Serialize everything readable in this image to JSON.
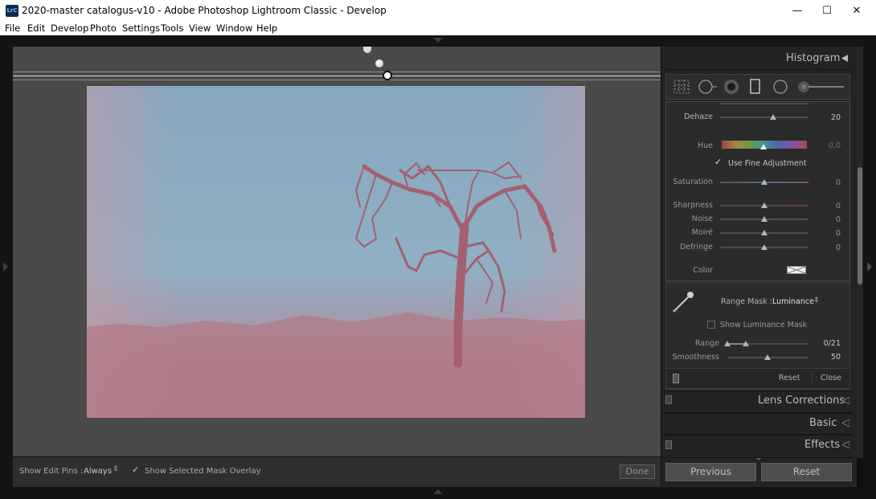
{
  "window": {
    "title": "2020-master catalogus-v10 - Adobe Photoshop Lightroom Classic - Develop",
    "app_icon_text": "LrC",
    "minimize_glyph": "—",
    "maximize_glyph": "☐",
    "close_glyph": "✕"
  },
  "menu": [
    {
      "label": "File"
    },
    {
      "label": "Edit"
    },
    {
      "label": "Develop"
    },
    {
      "label": "Photo"
    },
    {
      "label": "Settings"
    },
    {
      "label": "Tools"
    },
    {
      "label": "View"
    },
    {
      "label": "Window"
    },
    {
      "label": "Help"
    }
  ],
  "toolbar": {
    "show_edit_pins_label": "Show Edit Pins :",
    "show_edit_pins_value": "Always",
    "overlay_label": "Show Selected Mask Overlay",
    "overlay_checked": true,
    "done_label": "Done"
  },
  "panel": {
    "histogram_title": "Histogram",
    "tools": [
      "crop-overlay-icon",
      "spot-removal-icon",
      "red-eye-icon",
      "graduated-filter-icon",
      "radial-filter-icon",
      "adjustment-brush-icon"
    ],
    "sliders": [
      {
        "label": "Dehaze",
        "value": "20",
        "position": 0.6
      },
      {
        "label": "Saturation",
        "value": "0",
        "position": 0.5
      },
      {
        "label": "Sharpness",
        "value": "0",
        "position": 0.5
      },
      {
        "label": "Noise",
        "value": "0",
        "position": 0.5
      },
      {
        "label": "Moiré",
        "value": "0",
        "position": 0.5
      },
      {
        "label": "Defringe",
        "value": "0",
        "position": 0.5
      }
    ],
    "hue": {
      "label": "Hue",
      "value": "0,0",
      "position": 0.5
    },
    "fine_adjustment": {
      "label": "Use Fine Adjustment",
      "checked": true
    },
    "color_label": "Color",
    "range_mask": {
      "label": "Range Mask :",
      "value": "Luminance",
      "show_mask_label": "Show Luminance Mask",
      "show_mask_checked": false,
      "range_label": "Range",
      "range_value": "0/21",
      "smoothness_label": "Smoothness",
      "smoothness_value": "50",
      "smoothness_position": 0.5
    },
    "reset_label": "Reset",
    "close_label": "Close",
    "sections": [
      {
        "title": "Lens Corrections"
      },
      {
        "title": "Basic"
      },
      {
        "title": "Effects"
      }
    ],
    "previous_label": "Previous",
    "reset_button_label": "Reset"
  },
  "colors": {
    "canvas": "#4a4a4a",
    "panel": "#232323",
    "sky": "#7fa6bd",
    "ground": "#b37a86"
  }
}
